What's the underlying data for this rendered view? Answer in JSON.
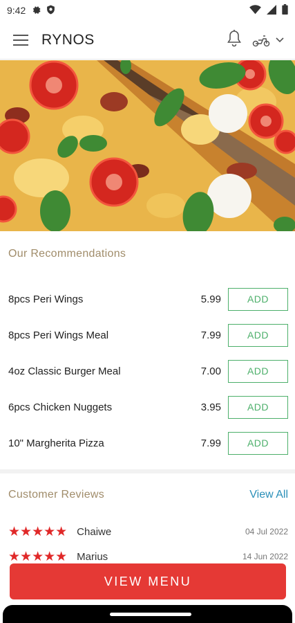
{
  "status_bar": {
    "time": "9:42"
  },
  "app_bar": {
    "title": "RYNOS"
  },
  "recommendations": {
    "title": "Our Recommendations",
    "items": [
      {
        "name": "8pcs Peri Wings",
        "price": "5.99",
        "button": "ADD"
      },
      {
        "name": "8pcs Peri Wings Meal",
        "price": "7.99",
        "button": "ADD"
      },
      {
        "name": "4oz Classic Burger Meal",
        "price": "7.00",
        "button": "ADD"
      },
      {
        "name": "6pcs Chicken Nuggets",
        "price": "3.95",
        "button": "ADD"
      },
      {
        "name": "10\" Margherita Pizza",
        "price": "7.99",
        "button": "ADD"
      }
    ]
  },
  "reviews": {
    "title": "Customer Reviews",
    "view_all": "View All",
    "items": [
      {
        "name": "Chaiwe",
        "date": "04 Jul 2022",
        "rating": 5
      },
      {
        "name": "Marius",
        "date": "14 Jun 2022",
        "rating": 5
      }
    ]
  },
  "view_menu": {
    "label": "VIEW MENU"
  },
  "colors": {
    "accent_red": "#e53935",
    "add_green": "#4caf6a",
    "link_blue": "#2a8fb8",
    "section_title": "#a08c6a"
  }
}
